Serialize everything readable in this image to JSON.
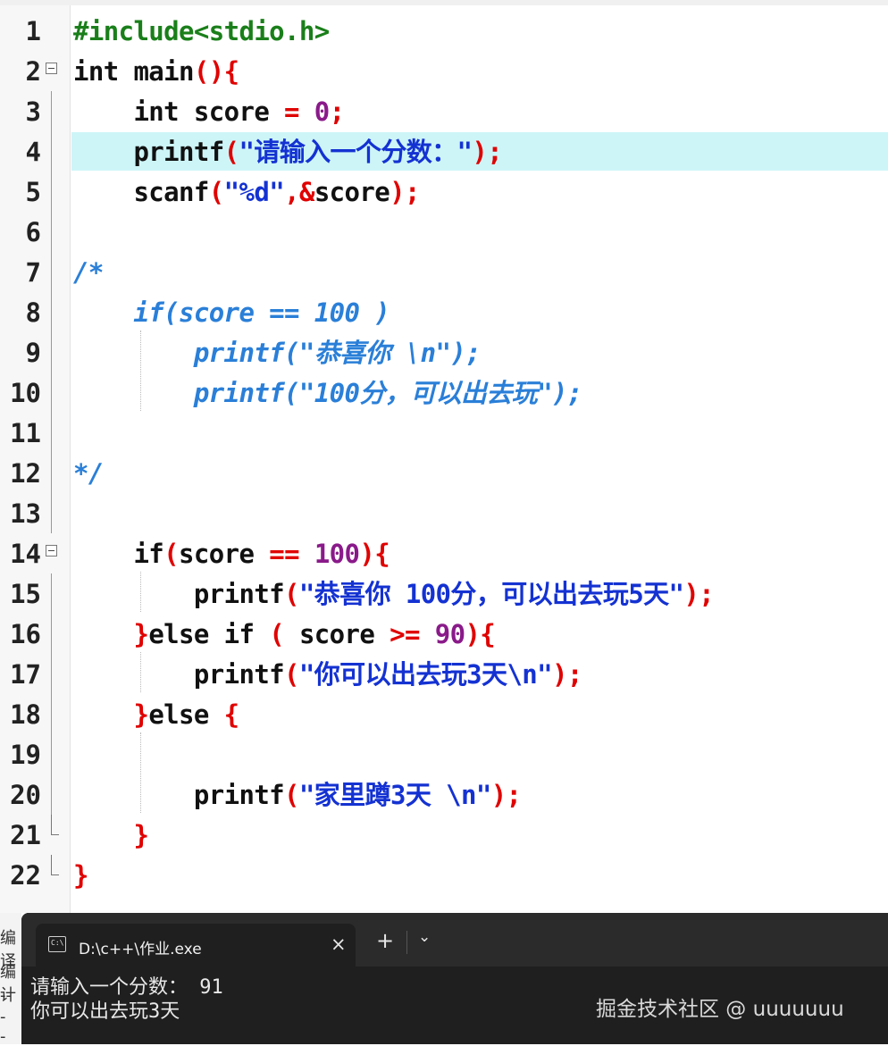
{
  "editor": {
    "lines": [
      {
        "n": "1",
        "tokens": [
          [
            "pre",
            "#include<stdio.h>"
          ]
        ]
      },
      {
        "n": "2",
        "tokens": [
          [
            "kw",
            "int main"
          ],
          [
            "op",
            "(){"
          ]
        ]
      },
      {
        "n": "3",
        "tokens": [
          [
            "kw",
            "    int score "
          ],
          [
            "op",
            "= "
          ],
          [
            "num",
            "0"
          ],
          [
            "op",
            ";"
          ]
        ]
      },
      {
        "n": "4",
        "tokens": [
          [
            "kw",
            "    printf"
          ],
          [
            "op",
            "("
          ],
          [
            "str",
            "\"请输入一个分数：\""
          ],
          [
            "op",
            ");"
          ]
        ]
      },
      {
        "n": "5",
        "tokens": [
          [
            "kw",
            "    scanf"
          ],
          [
            "op",
            "("
          ],
          [
            "str",
            "\"%d\""
          ],
          [
            "op",
            ",&"
          ],
          [
            "kw",
            "score"
          ],
          [
            "op",
            ");"
          ]
        ]
      },
      {
        "n": "6",
        "tokens": []
      },
      {
        "n": "7",
        "tokens": [
          [
            "cmt",
            "/*"
          ]
        ]
      },
      {
        "n": "8",
        "tokens": [
          [
            "cmt",
            "    if(score == 100 )"
          ]
        ]
      },
      {
        "n": "9",
        "tokens": [
          [
            "cmt",
            "        printf(\"恭喜你 \\n\");"
          ]
        ]
      },
      {
        "n": "10",
        "tokens": [
          [
            "cmt",
            "        printf(\"100分，可以出去玩\");"
          ]
        ]
      },
      {
        "n": "11",
        "tokens": []
      },
      {
        "n": "12",
        "tokens": [
          [
            "cmt",
            "*/"
          ]
        ]
      },
      {
        "n": "13",
        "tokens": []
      },
      {
        "n": "14",
        "tokens": [
          [
            "kw",
            "    if"
          ],
          [
            "op",
            "("
          ],
          [
            "kw",
            "score "
          ],
          [
            "op",
            "== "
          ],
          [
            "num",
            "100"
          ],
          [
            "op",
            "){"
          ]
        ]
      },
      {
        "n": "15",
        "tokens": [
          [
            "kw",
            "        printf"
          ],
          [
            "op",
            "("
          ],
          [
            "str",
            "\"恭喜你 100分，可以出去玩5天\""
          ],
          [
            "op",
            ");"
          ]
        ]
      },
      {
        "n": "16",
        "tokens": [
          [
            "op",
            "    }"
          ],
          [
            "kw",
            "else if "
          ],
          [
            "op",
            "( "
          ],
          [
            "kw",
            "score "
          ],
          [
            "op",
            ">= "
          ],
          [
            "num",
            "90"
          ],
          [
            "op",
            "){"
          ]
        ]
      },
      {
        "n": "17",
        "tokens": [
          [
            "kw",
            "        printf"
          ],
          [
            "op",
            "("
          ],
          [
            "str",
            "\"你可以出去玩3天\\n\""
          ],
          [
            "op",
            ");"
          ]
        ]
      },
      {
        "n": "18",
        "tokens": [
          [
            "op",
            "    }"
          ],
          [
            "kw",
            "else "
          ],
          [
            "op",
            "{"
          ]
        ]
      },
      {
        "n": "19",
        "tokens": []
      },
      {
        "n": "20",
        "tokens": [
          [
            "kw",
            "        printf"
          ],
          [
            "op",
            "("
          ],
          [
            "str",
            "\"家里蹲3天 \\n\""
          ],
          [
            "op",
            ");"
          ]
        ]
      },
      {
        "n": "21",
        "tokens": [
          [
            "op",
            "    }"
          ]
        ]
      },
      {
        "n": "22",
        "tokens": [
          [
            "op",
            "}"
          ]
        ]
      }
    ]
  },
  "left_stub": {
    "line1": "编译",
    "line2": "编计",
    "line3": "--",
    "line4": "-",
    "line5": "-"
  },
  "terminal": {
    "tab_icon_text": "C:\\",
    "tab_title": "D:\\c++\\作业.exe",
    "close_icon": "×",
    "new_tab_icon": "+",
    "dropdown_icon": "⌄",
    "output_line1": "请输入一个分数： 91",
    "output_line2": "你可以出去玩3天",
    "watermark": "掘金技术社区 @ uuuuuuu"
  },
  "colors": {
    "preprocessor": "#1a7f1a",
    "operator": "#e00000",
    "number": "#8a1a8a",
    "string": "#1432d2",
    "comment": "#2a7fd8",
    "highlight_line": "#cdf5f8",
    "terminal_bg": "#1f1f1f"
  }
}
